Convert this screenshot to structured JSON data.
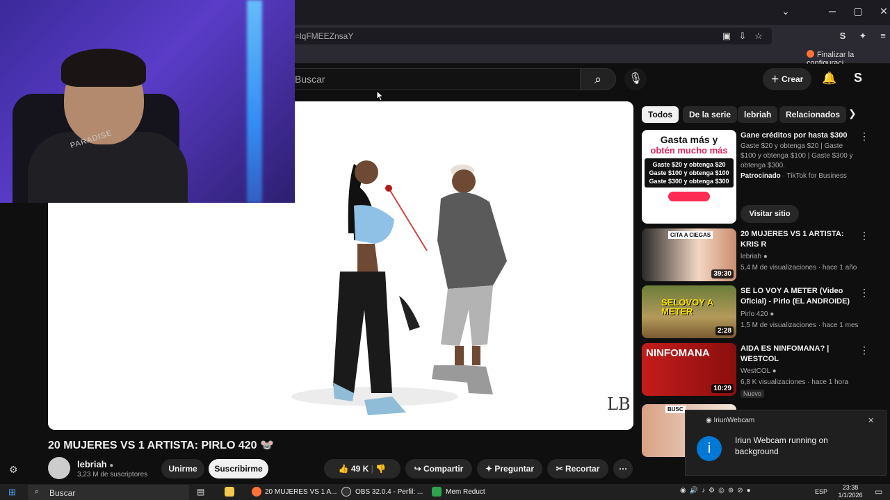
{
  "browser": {
    "url_fragment": "=lqFMEEZnsaY",
    "bookmark": "Finalizar la configuraci...",
    "window_controls": {
      "minimize": "─",
      "maximize": "▢",
      "close": "✕",
      "dropdown": "⌄"
    }
  },
  "youtube_header": {
    "search_placeholder": "Buscar",
    "create_label": "Crear"
  },
  "webcam": {
    "shirt_text": "PARADISE"
  },
  "video": {
    "title": "20 MUJERES VS 1 ARTISTA: PIRLO 420 🐭",
    "channel_name": "lebriah",
    "subscribers": "3,23 M de suscriptores",
    "join_label": "Unirme",
    "subscribe_label": "Suscribirme",
    "likes": "49 K",
    "share_label": "Compartir",
    "ask_label": "Preguntar",
    "clip_label": "Recortar",
    "watermark": "LB"
  },
  "chips": [
    "Todos",
    "De la serie",
    "lebriah",
    "Relacionados"
  ],
  "sidebar": {
    "ad": {
      "thumb_line1": "Gasta más y",
      "thumb_line2": "obtén mucho más",
      "thumb_line3": "Gaste $20 y obtenga $20",
      "thumb_line4": "Gaste $100 y obtenga $100",
      "thumb_line5": "Gaste $300 y obtenga $300",
      "title": "Gane créditos por hasta $300",
      "description": "Gaste $20 y obtenga $20 | Gaste $100 y obtenga $100 | Gaste $300 y obtenga $300.",
      "sponsored": "Patrocinado",
      "advertiser": "· TikTok for Business",
      "visit_label": "Visitar sitio"
    },
    "videos": [
      {
        "title": "20 MUJERES VS 1 ARTISTA: KRIS R",
        "channel": "lebriah",
        "meta": "5,4 M de visualizaciones · hace 1 año",
        "duration": "39:30",
        "thumb_label": "CITA A CIEGAS"
      },
      {
        "title": "SE LO VOY A METER (Video Oficial) - Pirlo (EL ANDROIDE)",
        "channel": "Pirlo 420",
        "meta": "1,5 M de visualizaciones · hace 1 mes",
        "duration": "2:28",
        "thumb_label": "SELOVOY A METER"
      },
      {
        "title": "AIDA ES NINFOMANA? | WESTCOL",
        "channel": "WestCOL",
        "meta": "6,8 K visualizaciones · hace 1 hora",
        "duration": "10:29",
        "thumb_label": "NINFOMANA",
        "badge": "Nuevo"
      },
      {
        "thumb_label": "BUSC"
      }
    ]
  },
  "notification": {
    "app": "IriunWebcam",
    "message": "Iriun Webcam running on background"
  },
  "taskbar": {
    "search": "Buscar",
    "tasks": [
      "20 MUJERES VS 1 A...",
      "OBS 32.0.4 - Perfil: ...",
      "Mem Reduct"
    ],
    "lang": "ESP",
    "time": "23:38",
    "date": "1/1/2026"
  },
  "colors": {
    "accent": "#ff0000",
    "bg": "#0f0f0f",
    "chip": "#272727"
  }
}
